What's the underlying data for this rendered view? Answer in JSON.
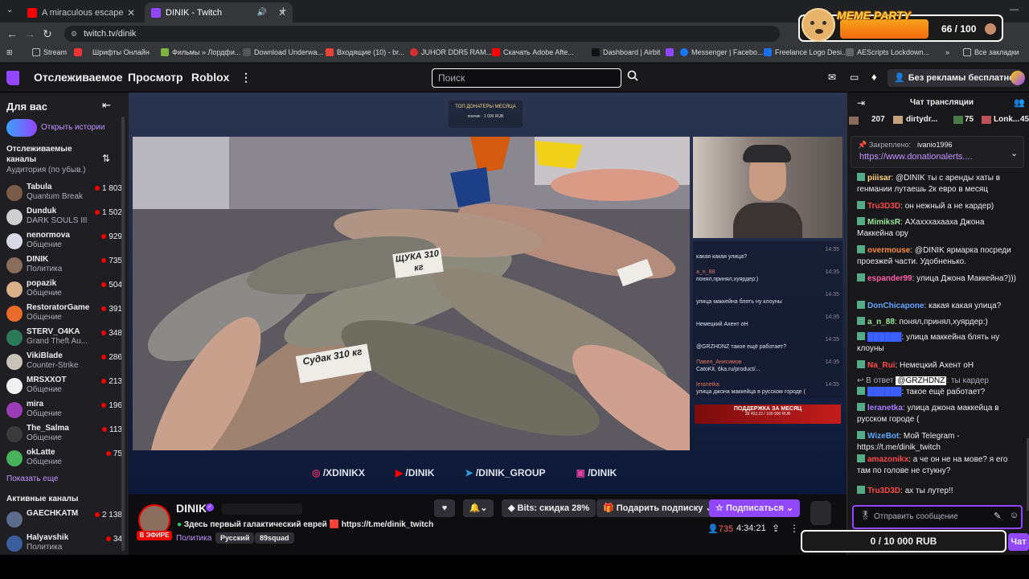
{
  "browser": {
    "tabs": [
      {
        "title": "A miraculous escape 🐉 🎰 ...",
        "active": false
      },
      {
        "title": "DINIK - Twitch",
        "active": true
      }
    ],
    "url": "twitch.tv/dinik",
    "bookmarks": [
      "Stream",
      "Шрифты Онлайн",
      "Фильмы » Лордфи...",
      "Download Underwa...",
      "Входящие (10) - br...",
      "JUHOR DDR5 RAM...",
      "Скачать Adobe Afte...",
      "Dashboard | Airbit",
      "Messenger | Facebo...",
      "Freelance Logo Desi...",
      "AEScripts Lockdown...",
      "Все закладки"
    ]
  },
  "overlay": {
    "brand": "MEME PARTY",
    "counter": "66 / 100"
  },
  "topbar": {
    "following": "Отслеживаемое",
    "browse": "Просмотр",
    "roblox": "Roblox",
    "search_placeholder": "Поиск",
    "ad_free": "Без рекламы бесплатно"
  },
  "sidebar": {
    "for_you": "Для вас",
    "open_stories": "Открыть истории",
    "followed_title": "Отслеживаемые каналы",
    "sort": "Аудитория (по убыв.)",
    "channels": [
      {
        "name": "Tabula",
        "game": "Quantum Break",
        "viewers": "1 803",
        "color": "#7a5a48"
      },
      {
        "name": "Dunduk",
        "game": "DARK SOULS III",
        "viewers": "1 502",
        "color": "#cfcfcf"
      },
      {
        "name": "nenormova",
        "game": "Общение",
        "viewers": "929",
        "color": "#d9d9e6"
      },
      {
        "name": "DINIK",
        "game": "Политика",
        "viewers": "735",
        "color": "#8a6d5c"
      },
      {
        "name": "popazik",
        "game": "Общение",
        "viewers": "504",
        "color": "#d8b08a"
      },
      {
        "name": "RestoratorGame",
        "game": "Общение",
        "viewers": "391",
        "color": "#e86b2a"
      },
      {
        "name": "STERV_O4KA",
        "game": "Grand Theft Au...",
        "viewers": "348",
        "color": "#2d7a59"
      },
      {
        "name": "VikiBlade",
        "game": "Counter-Strike",
        "viewers": "286",
        "color": "#c9c2b8"
      },
      {
        "name": "MRSXXOT",
        "game": "Общение",
        "viewers": "213",
        "color": "#f0f0f0"
      },
      {
        "name": "mira",
        "game": "Общение",
        "viewers": "196",
        "color": "#9b3cb7"
      },
      {
        "name": "The_Salma",
        "game": "Общение",
        "viewers": "113",
        "color": "#3a3a3a"
      },
      {
        "name": "okLatte",
        "game": "Общение",
        "viewers": "75",
        "color": "#46b35a"
      }
    ],
    "show_more": "Показать еще",
    "active_title": "Активные каналы",
    "active_channels": [
      {
        "name": "GAECHKATM",
        "game": "",
        "viewers": "2 138",
        "color": "#5a6b8c"
      },
      {
        "name": "Halyavshik",
        "game": "Политика",
        "viewers": "34",
        "color": "#3b5f9e"
      }
    ]
  },
  "video": {
    "top_donors_title": "ТОП ДОНАТЕРЫ МЕСЯЦА",
    "top_donor": "поичик · 1 000 RUB",
    "price_tag_1": "ЩУКА 310 кг",
    "price_tag_2": "Судак 310 кг",
    "support_title": "ПОДДЕРЖКА ЗА МЕСЯЦ",
    "support_amount": "38 453.22 / 100 000 RUB",
    "socials": [
      "/XDINIKX",
      "/DINIK",
      "/DINIK_GROUP",
      "/DINIK"
    ],
    "overlay_chat": [
      {
        "user": "",
        "text": "какая какая улица?",
        "time": "14:35"
      },
      {
        "user": "a_n_88",
        "text": "понял,принял,хуярдер:)",
        "time": "14:35"
      },
      {
        "user": "",
        "text": "улица маккейна блять ну клоуны",
        "time": "14:35"
      },
      {
        "user": "",
        "text": "Немецкий Ахент оН",
        "time": "14:35"
      },
      {
        "user": "",
        "text": "@GRZHDNZ такое ещё работает?",
        "time": "14:35"
      },
      {
        "user": "Павел_Анисимов",
        "text": "CatoKit, 6ka.ru/product/...",
        "time": "14:35"
      },
      {
        "user": "leranetka",
        "text": "улица джона маккейца в русском городе (",
        "time": "14:35"
      }
    ]
  },
  "stream": {
    "channel": "DINIK",
    "live": "В ЭФИРЕ",
    "title_text": "Здесь первый галактический еврей 🟥 https://t.me/dinik_twitch",
    "category": "Политика",
    "tags": [
      "Русский",
      "89squad"
    ],
    "bits": "Bits: скидка 28%",
    "gift": "Подарить подписку",
    "subscribe": "Подписаться",
    "viewers": "735",
    "uptime": "4:34:21",
    "goal": "0 / 10 000 RUB"
  },
  "chat": {
    "title": "Чат трансляции",
    "leaderboard": [
      {
        "name": "",
        "value": "207"
      },
      {
        "name": "dirtydr...",
        "value": "75"
      },
      {
        "name": "Lonk...",
        "value": "45"
      }
    ],
    "pinned_label": "Закреплено:",
    "pinned_user": "ivanio1996",
    "pinned_link": "https://www.donationalerts....",
    "messages": [
      {
        "user": "piiisar",
        "color": "#ffd37a",
        "text": "@DINIK ты с аренды хаты в генмании лутаешь 2к евро в месяц"
      },
      {
        "user": "Tru3D3D",
        "color": "#ff4a4a",
        "text": "он нежный а не кардер)"
      },
      {
        "user": "MimiksR",
        "color": "#9be89b",
        "text": "АХахххахааха Джона Маккейна ору"
      },
      {
        "user": "overmouse",
        "color": "#ff8c3a",
        "text": "@DINIK ярмарка посреди проезжей части. Удобненько."
      },
      {
        "user": "espander99",
        "color": "#ff5fa8",
        "text": "улица Джона Маккейна?)))"
      },
      {
        "user": "DonChicapone",
        "color": "#5ea6ff",
        "text": "какая какая улица?"
      },
      {
        "user": "a_n_88",
        "color": "#9be89b",
        "text": "понял,принял,хуярдер:)"
      },
      {
        "user": "",
        "color": "#3b5fff",
        "text": "улица маккейна блять ну клоуны"
      },
      {
        "user": "Na_Rui",
        "color": "#ff4a4a",
        "text": "Немецкий Ахент оН"
      },
      {
        "user": "",
        "color": "#3b5fff",
        "text": "такое ещё работает?"
      },
      {
        "user": "leranetka",
        "color": "#a77bff",
        "text": "улица джона маккейца в русском городе ("
      },
      {
        "user": "WizeBot",
        "color": "#5ea6ff",
        "text": "Мой Telegram - https://t.me/dinik_twitch"
      },
      {
        "user": "amazonikx",
        "color": "#ff4a4a",
        "text": "а че он не на мове? я его там по голове не стукну?"
      },
      {
        "user": "Tru3D3D",
        "color": "#ff4a4a",
        "text": "ах ты лутер!!"
      }
    ],
    "reply_label": "В ответ",
    "reply_to": "@GRZHDNZ",
    "reply_tail": "ты кардер",
    "input_placeholder": "Отправить сообщение",
    "chat_button": "Чат"
  }
}
